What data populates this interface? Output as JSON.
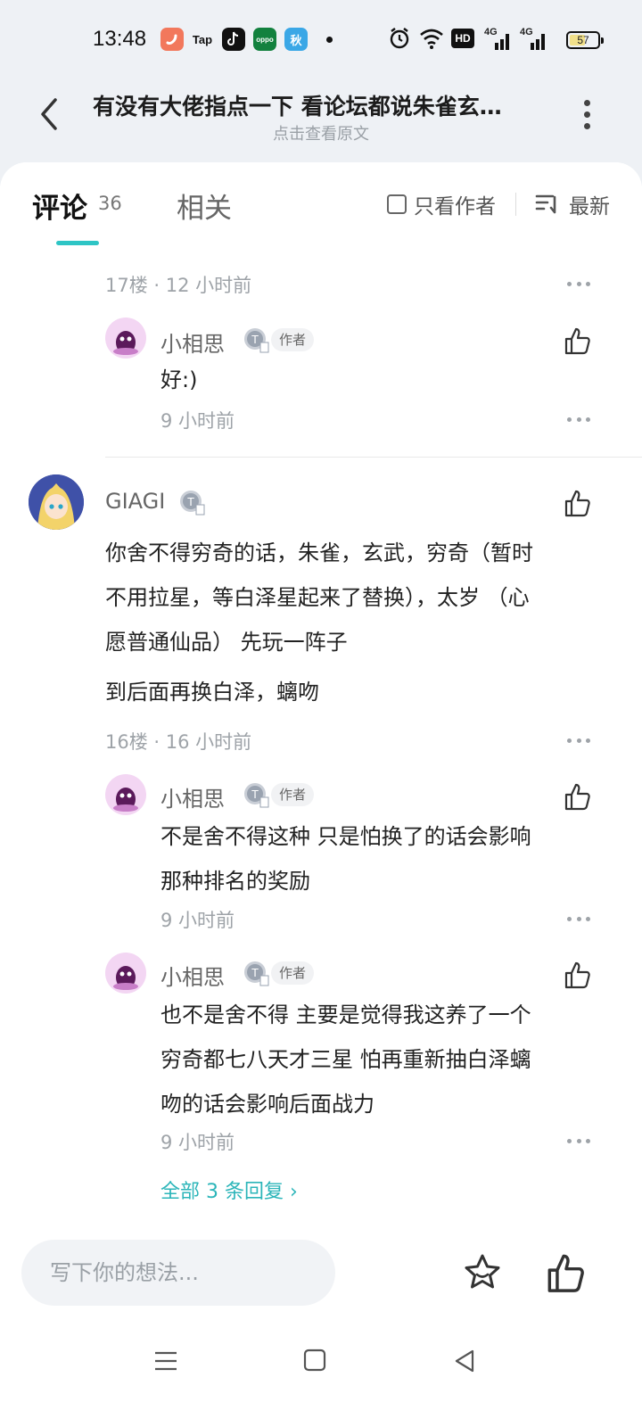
{
  "status_bar": {
    "time": "13:48",
    "app_icons": [
      {
        "name": "pepper-app-icon",
        "color": "#f2785c",
        "label": ""
      },
      {
        "name": "tap-app-icon",
        "color": "#ffffff",
        "label": "Tap"
      },
      {
        "name": "tiktok-app-icon",
        "color": "#111111",
        "label": ""
      },
      {
        "name": "oppo-app-icon",
        "color": "#12813e",
        "label": "oppo"
      },
      {
        "name": "blue-app-icon",
        "color": "#3aa7e6",
        "label": "秋"
      }
    ],
    "network_label": "HD",
    "signal_1": "4G",
    "signal_2": "4G",
    "battery": "57",
    "battery_level": 0.57
  },
  "header": {
    "title": "有没有大佬指点一下 看论坛都说朱雀玄…",
    "subtitle": "点击查看原文"
  },
  "tabs": {
    "comments_label": "评论",
    "comments_count": "36",
    "related_label": "相关",
    "author_only_label": "只看作者",
    "sort_label": "最新"
  },
  "comments": {
    "c17": {
      "meta": "17楼 · 12 小时前",
      "replies": [
        {
          "user": "小相思",
          "tag": "作者",
          "text": "好:)",
          "time": "9 小时前"
        }
      ]
    },
    "c16": {
      "user": "GIAGI",
      "text_lines": [
        "你舍不得穷奇的话，朱雀，玄武，穷奇（暂时",
        "不用拉星，等白泽星起来了替换），太岁 （心",
        "愿普通仙品） 先玩一阵子"
      ],
      "text2": "到后面再换白泽，螭吻",
      "meta": "16楼 · 16 小时前",
      "replies": [
        {
          "user": "小相思",
          "tag": "作者",
          "text_lines": [
            "不是舍不得这种 只是怕换了的话会影响",
            "那种排名的奖励"
          ],
          "time": "9 小时前"
        },
        {
          "user": "小相思",
          "tag": "作者",
          "text_lines": [
            "也不是舍不得 主要是觉得我这养了一个",
            "穷奇都七八天才三星 怕再重新抽白泽螭",
            "吻的话会影响后面战力"
          ],
          "time": "9 小时前"
        }
      ],
      "all_replies": "全部 3 条回复 ›"
    }
  },
  "bottom": {
    "input_placeholder": "写下你的想法..."
  },
  "colors": {
    "accent": "#2ec5c5",
    "link": "#2bb5b9",
    "muted": "#9ea3a8"
  }
}
